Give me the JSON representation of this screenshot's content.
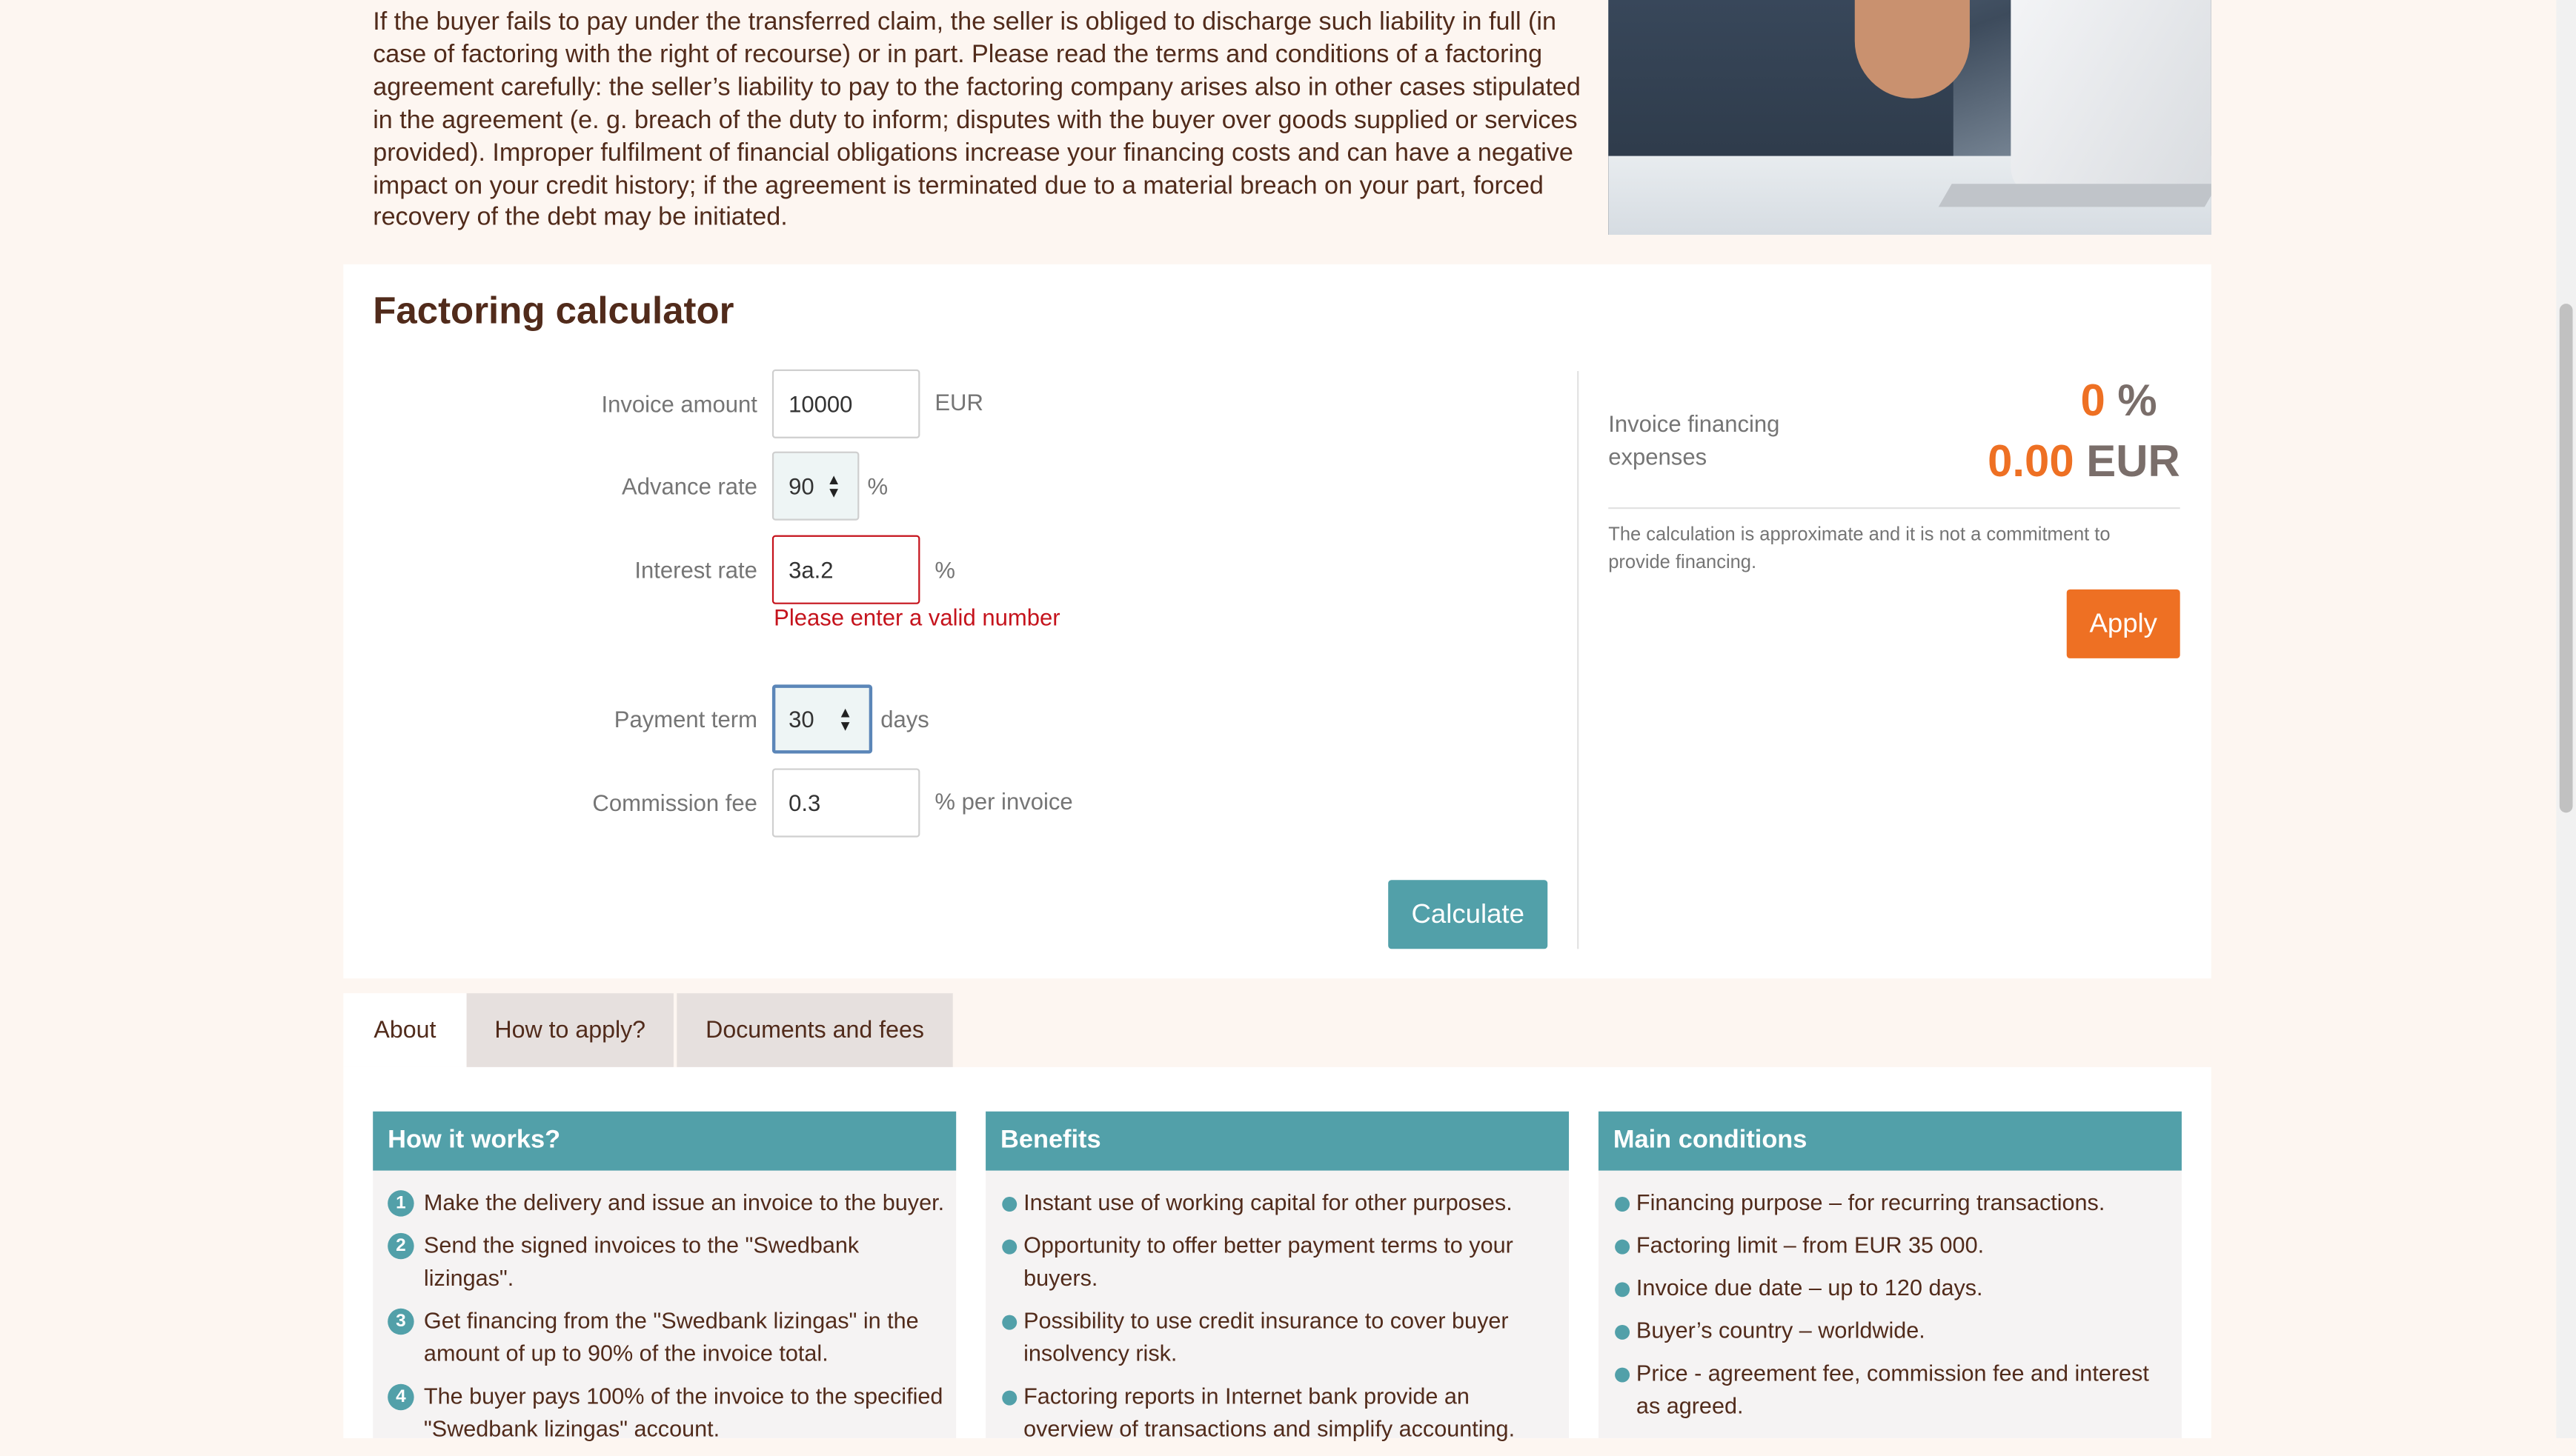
{
  "intro": {
    "text": "If the buyer fails to pay under the transferred claim, the seller is obliged to discharge such liability in full (in case of factoring with the right of recourse) or in part. Please read the terms and conditions of a factoring agreement carefully: the seller’s liability to pay to the factoring company arises also in other cases stipulated in the agreement (e. g. breach of the duty to inform; disputes with the buyer over goods supplied or services provided). Improper fulfilment of financial obligations increase your financing costs and can have a negative impact on your credit history; if the agreement is terminated due to a material breach on your part, forced recovery of the debt may be initiated."
  },
  "calculator": {
    "title": "Factoring calculator",
    "fields": {
      "invoice_amount": {
        "label": "Invoice amount",
        "value": "10000",
        "unit": "EUR"
      },
      "advance_rate": {
        "label": "Advance rate",
        "value": "90",
        "unit": "%"
      },
      "interest_rate": {
        "label": "Interest rate",
        "value": "3a.2",
        "unit": "%",
        "error": "Please enter a valid number"
      },
      "payment_term": {
        "label": "Payment term",
        "value": "30",
        "unit": "days"
      },
      "commission_fee": {
        "label": "Commission fee",
        "value": "0.3",
        "unit": "% per invoice"
      }
    },
    "calculate_label": "Calculate",
    "result": {
      "label": "Invoice financing expenses",
      "percent_value": "0",
      "percent_unit": "%",
      "amount_value": "0.00",
      "amount_unit": "EUR",
      "disclaimer": "The calculation is approximate and it is not a commitment to provide financing.",
      "apply_label": "Apply"
    }
  },
  "tabs": [
    {
      "label": "About",
      "active": true
    },
    {
      "label": "How to apply?",
      "active": false
    },
    {
      "label": "Documents and fees",
      "active": false
    }
  ],
  "cards": {
    "how_it_works": {
      "title": "How it works?",
      "items": [
        {
          "num": "1",
          "text": "Make the delivery and issue an invoice to the buyer."
        },
        {
          "num": "2",
          "text": "Send the signed invoices to the \"Swedbank lizingas\"."
        },
        {
          "num": "3",
          "text": "Get financing from the \"Swedbank lizingas\" in the amount of up to 90% of the invoice total."
        },
        {
          "num": "4",
          "text": "The buyer pays 100% of the invoice to the specified \"Swedbank lizingas\" account."
        }
      ]
    },
    "benefits": {
      "title": "Benefits",
      "items": [
        "Instant use of working capital for other purposes.",
        "Opportunity to offer better payment terms to your buyers.",
        "Possibility to use credit insurance to cover buyer insolvency risk.",
        "Factoring reports in Internet bank provide an overview of transactions and simplify accounting."
      ]
    },
    "main_conditions": {
      "title": "Main conditions",
      "items": [
        "Financing purpose – for recurring transactions.",
        "Factoring limit – from EUR 35 000.",
        "Invoice due date – up to 120 days.",
        "Buyer’s country – worldwide.",
        "Price - agreement fee, commission fee and interest as agreed."
      ]
    }
  },
  "colors": {
    "brand_brown": "#512b1b",
    "brand_orange": "#ee7023",
    "teal": "#52a0a9",
    "error_red": "#c5131c"
  }
}
